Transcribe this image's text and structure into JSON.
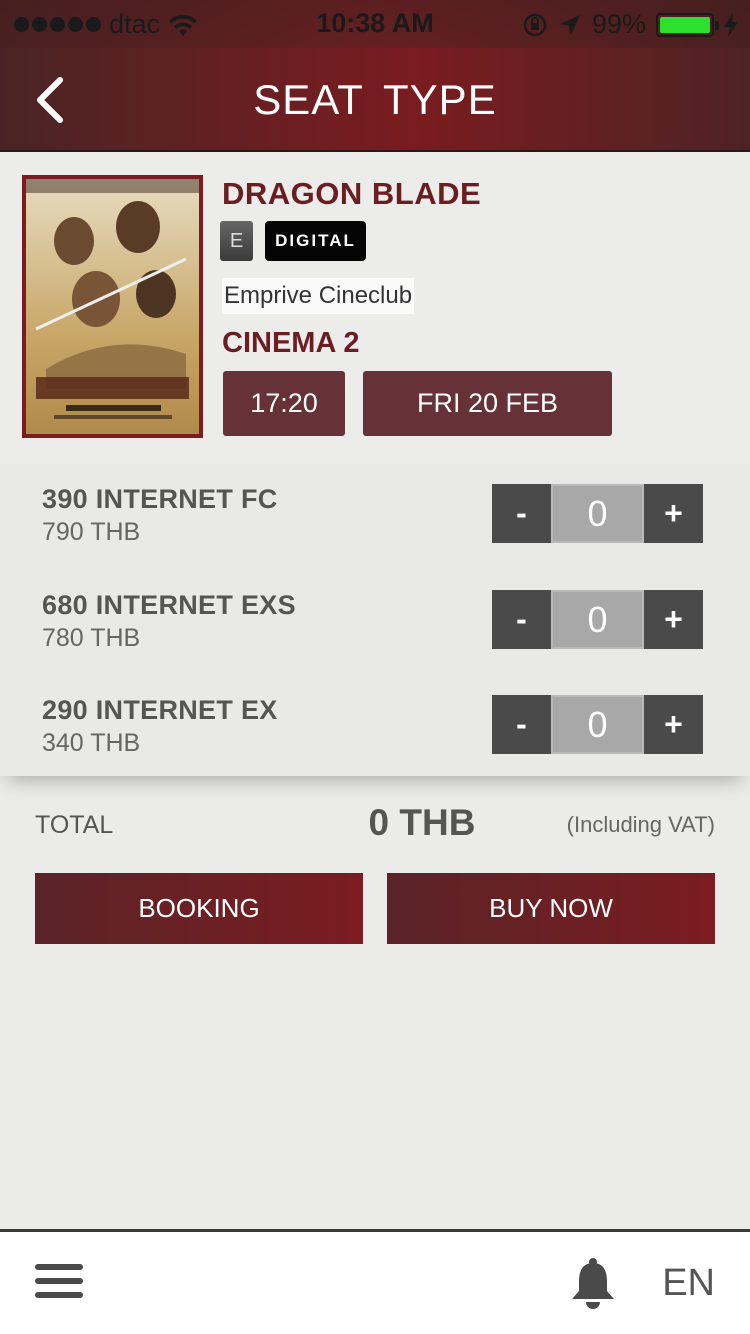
{
  "status_bar": {
    "carrier": "dtac",
    "time": "10:38 AM",
    "battery": "99%",
    "battery_level": 0.99
  },
  "header": {
    "title": "SEAT TYPE"
  },
  "movie": {
    "title": "DRAGON BLADE",
    "rating": "E",
    "format": "DIGITAL",
    "cinema": "Emprive Cineclub",
    "hall": "CINEMA 2",
    "time": "17:20",
    "date": "FRI 20 FEB"
  },
  "seat_types": [
    {
      "name": "390 INTERNET FC",
      "price": "790 THB",
      "qty": "0",
      "minus": "-",
      "plus": "+"
    },
    {
      "name": "680 INTERNET EXS",
      "price": "780 THB",
      "qty": "0",
      "minus": "-",
      "plus": "+"
    },
    {
      "name": "290 INTERNET EX",
      "price": "340 THB",
      "qty": "0",
      "minus": "-",
      "plus": "+"
    }
  ],
  "total": {
    "label": "TOTAL",
    "value": "0 THB",
    "note": "(Including VAT)"
  },
  "actions": {
    "booking": "BOOKING",
    "buy_now": "BUY NOW"
  },
  "bottom_bar": {
    "menu_icon": "menu-icon",
    "bell_icon": "bell-icon",
    "language": "EN"
  },
  "colors": {
    "brand": "#7b1c20",
    "chip": "#663238",
    "stepper": "#4a4a4a",
    "battery": "#2ee02e"
  }
}
